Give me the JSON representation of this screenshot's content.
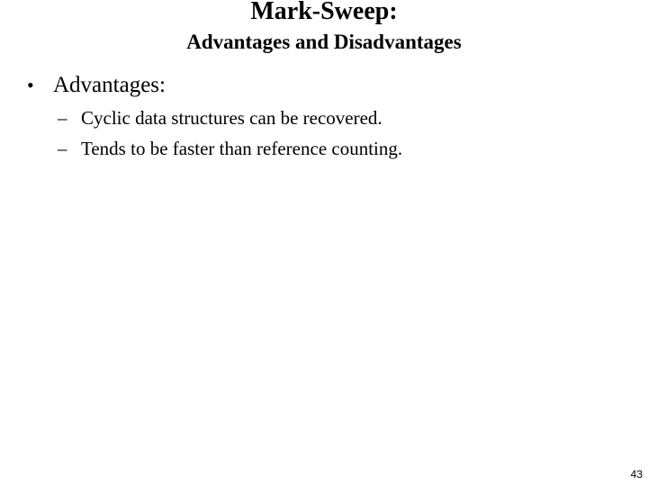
{
  "slide": {
    "title": "Mark-Sweep:",
    "subtitle": "Advantages and Disadvantages",
    "bullets": [
      {
        "marker": "•",
        "text": "Advantages:",
        "subitems": [
          {
            "marker": "–",
            "text": "Cyclic data structures can be recovered."
          },
          {
            "marker": "–",
            "text": "Tends to be faster than reference counting."
          }
        ]
      }
    ],
    "page_number": "43"
  }
}
